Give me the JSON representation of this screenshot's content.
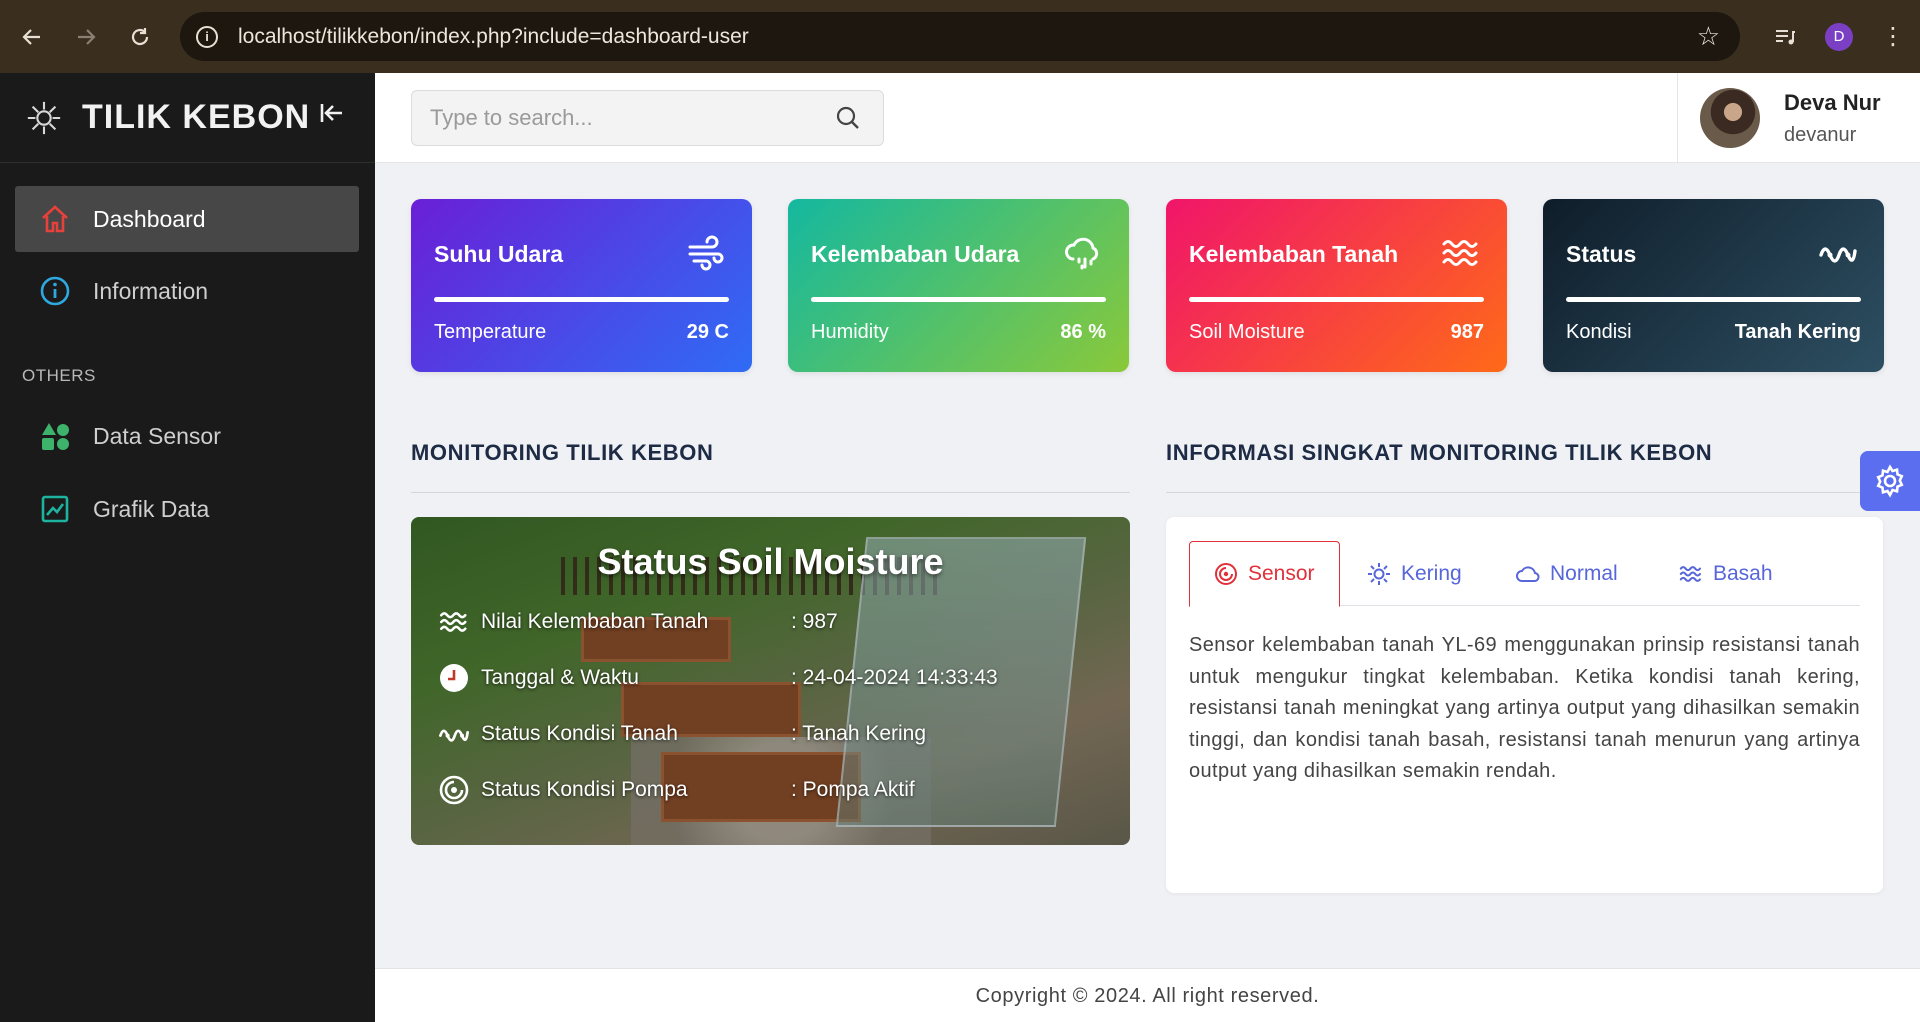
{
  "browser": {
    "url": "localhost/tilikkebon/index.php?include=dashboard-user",
    "profile_initial": "D"
  },
  "sidebar": {
    "brand": "TILIK KEBON",
    "items": [
      {
        "label": "Dashboard",
        "icon": "home-icon",
        "active": true
      },
      {
        "label": "Information",
        "icon": "info-circle-icon",
        "active": false
      }
    ],
    "section_label": "OTHERS",
    "others": [
      {
        "label": "Data Sensor",
        "icon": "shapes-icon"
      },
      {
        "label": "Grafik Data",
        "icon": "chart-icon"
      }
    ]
  },
  "topbar": {
    "search_placeholder": "Type to search...",
    "user_name": "Deva Nur",
    "user_handle": "devanur"
  },
  "cards": [
    {
      "title": "Suhu Udara",
      "label": "Temperature",
      "value": "29 C",
      "icon": "wind-icon"
    },
    {
      "title": "Kelembaban Udara",
      "label": "Humidity",
      "value": "86 %",
      "icon": "cloud-rain-icon"
    },
    {
      "title": "Kelembaban Tanah",
      "label": "Soil Moisture",
      "value": "987",
      "icon": "waves-icon"
    },
    {
      "title": "Status",
      "label": "Kondisi",
      "value": "Tanah Kering",
      "icon": "pulse-icon"
    }
  ],
  "monitoring": {
    "section_title": "MONITORING TILIK KEBON",
    "panel_title": "Status Soil Moisture",
    "rows": [
      {
        "label": "Nilai Kelembaban Tanah",
        "value": ": 987",
        "icon": "waves-icon"
      },
      {
        "label": "Tanggal & Waktu",
        "value": ": 24-04-2024 14:33:43",
        "icon": "clock-icon"
      },
      {
        "label": "Status Kondisi Tanah",
        "value": ": Tanah Kering",
        "icon": "pulse-icon"
      },
      {
        "label": "Status Kondisi Pompa",
        "value": ": Pompa Aktif",
        "icon": "pump-icon"
      }
    ]
  },
  "info": {
    "section_title": "INFORMASI SINGKAT MONITORING TILIK KEBON",
    "tabs": [
      {
        "label": "Sensor",
        "icon": "sensor-icon",
        "active": true
      },
      {
        "label": "Kering",
        "icon": "sun-icon",
        "active": false
      },
      {
        "label": "Normal",
        "icon": "cloud-icon",
        "active": false
      },
      {
        "label": "Basah",
        "icon": "waves-icon",
        "active": false
      }
    ],
    "text": "Sensor kelembaban tanah YL-69 menggunakan prinsip resistansi tanah untuk mengukur tingkat kelembaban. Ketika kondisi tanah kering, resistansi tanah meningkat yang artinya output yang dihasilkan semakin tinggi, dan kondisi tanah basah, resistansi tanah menurun yang artinya output yang dihasilkan semakin rendah."
  },
  "footer": {
    "text": "Copyright © 2024. All right reserved."
  },
  "colors": {
    "sidebar_bg": "#1a1a1a",
    "accent": "#5766d9",
    "active_tab": "#e0313b"
  }
}
